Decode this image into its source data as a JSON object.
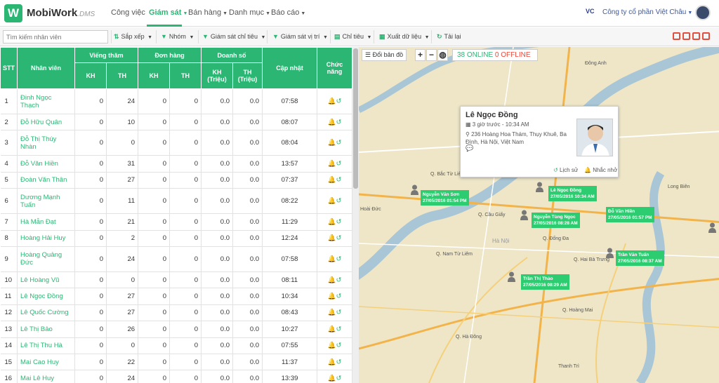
{
  "brand": {
    "logo": "W",
    "name": "MobiWork",
    "suffix": ".DMS"
  },
  "nav": [
    "Công việc",
    "Giám sát",
    "Bán hàng",
    "Danh mục",
    "Báo cáo"
  ],
  "company": {
    "logo_text": "VC",
    "name": "Công ty cổ phần Việt Châu"
  },
  "toolbar": {
    "search_placeholder": "Tìm kiếm nhân viên",
    "sort": "Sắp xếp",
    "group": "Nhóm",
    "monitor_target": "Giám sát chỉ tiêu",
    "monitor_location": "Giám sát vị trí",
    "target": "Chỉ tiêu",
    "export": "Xuất dữ liệu",
    "reload": "Tải lại"
  },
  "table": {
    "headers": {
      "stt": "STT",
      "employee": "Nhân viên",
      "visit": "Viếng thăm",
      "order": "Đơn hàng",
      "revenue": "Doanh số",
      "kh": "KH",
      "th": "TH",
      "kh_m": "KH (Triệu)",
      "th_m": "TH (Triệu)",
      "update": "Cập nhật",
      "function": "Chức năng"
    },
    "rows": [
      {
        "stt": "1",
        "name": "Đinh Ngọc Thạch",
        "v_kh": "0",
        "v_th": "24",
        "o_kh": "0",
        "o_th": "0",
        "r_kh": "0.0",
        "r_th": "0.0",
        "upd": "07:58",
        "tall": true
      },
      {
        "stt": "2",
        "name": "Đỗ Hữu Quân",
        "v_kh": "0",
        "v_th": "10",
        "o_kh": "0",
        "o_th": "0",
        "r_kh": "0.0",
        "r_th": "0.0",
        "upd": "08:07",
        "tall": false
      },
      {
        "stt": "3",
        "name": "Đỗ Thị Thúy Nhàn",
        "v_kh": "0",
        "v_th": "0",
        "o_kh": "0",
        "o_th": "0",
        "r_kh": "0.0",
        "r_th": "0.0",
        "upd": "08:04",
        "tall": true
      },
      {
        "stt": "4",
        "name": "Đỗ Văn Hiền",
        "v_kh": "0",
        "v_th": "31",
        "o_kh": "0",
        "o_th": "0",
        "r_kh": "0.0",
        "r_th": "0.0",
        "upd": "13:57",
        "tall": false
      },
      {
        "stt": "5",
        "name": "Đoàn Văn Thân",
        "v_kh": "0",
        "v_th": "27",
        "o_kh": "0",
        "o_th": "0",
        "r_kh": "0.0",
        "r_th": "0.0",
        "upd": "07:37",
        "tall": false
      },
      {
        "stt": "6",
        "name": "Dương Mạnh Tuấn",
        "v_kh": "0",
        "v_th": "11",
        "o_kh": "0",
        "o_th": "0",
        "r_kh": "0.0",
        "r_th": "0.0",
        "upd": "08:22",
        "tall": true
      },
      {
        "stt": "7",
        "name": "Hà Mẫn Đạt",
        "v_kh": "0",
        "v_th": "21",
        "o_kh": "0",
        "o_th": "0",
        "r_kh": "0.0",
        "r_th": "0.0",
        "upd": "11:29",
        "tall": false
      },
      {
        "stt": "8",
        "name": "Hoàng Hải Huy",
        "v_kh": "0",
        "v_th": "2",
        "o_kh": "0",
        "o_th": "0",
        "r_kh": "0.0",
        "r_th": "0.0",
        "upd": "12:24",
        "tall": false
      },
      {
        "stt": "9",
        "name": "Hoàng Quảng Đức",
        "v_kh": "0",
        "v_th": "24",
        "o_kh": "0",
        "o_th": "0",
        "r_kh": "0.0",
        "r_th": "0.0",
        "upd": "07:58",
        "tall": true
      },
      {
        "stt": "10",
        "name": "Lê Hoàng Vũ",
        "v_kh": "0",
        "v_th": "0",
        "o_kh": "0",
        "o_th": "0",
        "r_kh": "0.0",
        "r_th": "0.0",
        "upd": "08:11",
        "tall": false
      },
      {
        "stt": "11",
        "name": "Lê Ngọc Đồng",
        "v_kh": "0",
        "v_th": "27",
        "o_kh": "0",
        "o_th": "0",
        "r_kh": "0.0",
        "r_th": "0.0",
        "upd": "10:34",
        "tall": false
      },
      {
        "stt": "12",
        "name": "Lê Quốc Cường",
        "v_kh": "0",
        "v_th": "27",
        "o_kh": "0",
        "o_th": "0",
        "r_kh": "0.0",
        "r_th": "0.0",
        "upd": "08:43",
        "tall": false
      },
      {
        "stt": "13",
        "name": "Lê Thị Bảo",
        "v_kh": "0",
        "v_th": "26",
        "o_kh": "0",
        "o_th": "0",
        "r_kh": "0.0",
        "r_th": "0.0",
        "upd": "10:27",
        "tall": false
      },
      {
        "stt": "14",
        "name": "Lê Thị Thu Hà",
        "v_kh": "0",
        "v_th": "0",
        "o_kh": "0",
        "o_th": "0",
        "r_kh": "0.0",
        "r_th": "0.0",
        "upd": "07:55",
        "tall": false
      },
      {
        "stt": "15",
        "name": "Mai Cao Huy",
        "v_kh": "0",
        "v_th": "22",
        "o_kh": "0",
        "o_th": "0",
        "r_kh": "0.0",
        "r_th": "0.0",
        "upd": "11:37",
        "tall": false
      },
      {
        "stt": "16",
        "name": "Mai Lê Huy",
        "v_kh": "0",
        "v_th": "24",
        "o_kh": "0",
        "o_th": "0",
        "r_kh": "0.0",
        "r_th": "0.0",
        "upd": "13:39",
        "tall": false
      }
    ]
  },
  "map": {
    "change_map": "Đổi bản đồ",
    "online": "38 ONLINE",
    "offline": "0 OFFLINE",
    "popup": {
      "name": "Lê Ngọc Đồng",
      "time": "3 giờ trước - 10:34 AM",
      "address": "236 Hoàng Hoa Thám, Thụy Khuê, Ba Đình, Hà Nội, Việt Nam",
      "history": "Lịch sử",
      "remind": "Nhắc nhở"
    },
    "markers": [
      {
        "name": "Nguyễn Văn Sơn",
        "time": "27/05/2016 01:54 PM"
      },
      {
        "name": "Lê Ngọc Đồng",
        "time": "27/05/2016 10:34 AM"
      },
      {
        "name": "Nguyễn Tùng Ngọc",
        "time": "27/05/2016 08:28 AM"
      },
      {
        "name": "Đỗ Văn Hiền",
        "time": "27/05/2016 01:57 PM"
      },
      {
        "name": "Trần Văn Tuấn",
        "time": "27/05/2016 08:37 AM"
      },
      {
        "name": "Trần Thị Thảo",
        "time": "27/05/2016 08:29 AM"
      }
    ],
    "places": [
      "Đông Anh",
      "Hoài Đức",
      "Hà Nội",
      "Q. Bắc Từ Liêm",
      "Q. Cầu Giấy",
      "Q. Nam Từ Liêm",
      "Q. Hai Bà Trưng",
      "Q. Hoàng Mai",
      "Q. Hà Đông",
      "Thanh Trì",
      "Q. Đống Đa",
      "Long Biên"
    ]
  }
}
